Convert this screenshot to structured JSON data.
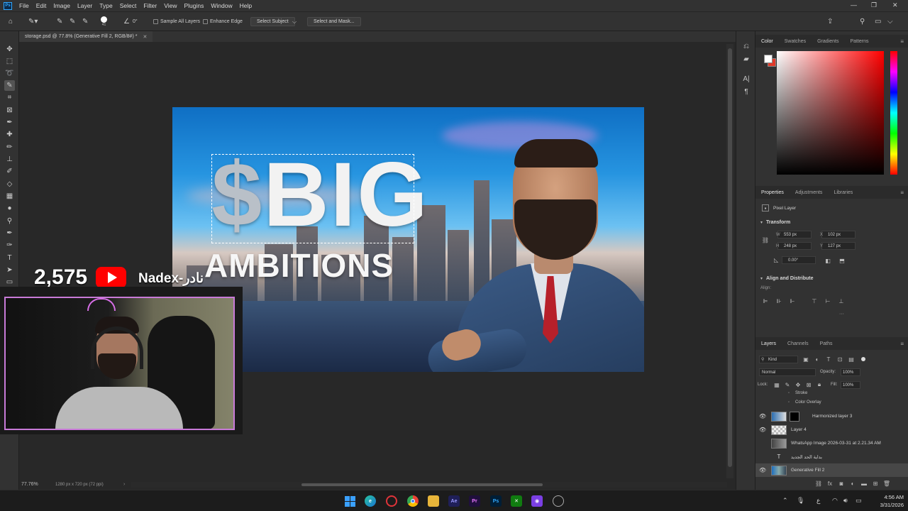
{
  "menubar": {
    "items": [
      "File",
      "Edit",
      "Image",
      "Layer",
      "Type",
      "Select",
      "Filter",
      "View",
      "Plugins",
      "Window",
      "Help"
    ]
  },
  "options": {
    "brush_size": "41",
    "angle": "0°",
    "sample_all_layers": "Sample All Layers",
    "enhance_edge": "Enhance Edge",
    "select_subject": "Select Subject",
    "select_and_mask": "Select and Mask..."
  },
  "document": {
    "tab_title": "storage.psd @ 77.8% (Generative Fill 2, RGB/8#) *",
    "zoom": "77.76%",
    "dimensions": "1280 px x 720 px (72 ppi)"
  },
  "artwork": {
    "headline": "BIG",
    "dollar_glyph": "$",
    "subheadline": "AMBITIONS"
  },
  "color_panel": {
    "tabs": [
      "Color",
      "Swatches",
      "Gradients",
      "Patterns"
    ],
    "active_tab": "Color",
    "foreground": "#ffffff",
    "background": "#e03a2a",
    "hue": "#ff0000"
  },
  "properties": {
    "tabs": [
      "Properties",
      "Adjustments",
      "Libraries"
    ],
    "layer_type": "Pixel Layer",
    "transform_title": "Transform",
    "w_label": "W",
    "h_label": "H",
    "x_label": "X",
    "y_label": "Y",
    "w": "553 px",
    "h": "248 px",
    "x": "102 px",
    "y": "127 px",
    "angle": "0.00°",
    "align_title": "Align and Distribute",
    "align_label": "Align:"
  },
  "layers": {
    "tabs": [
      "Layers",
      "Channels",
      "Paths"
    ],
    "filter": "Kind",
    "blend_mode": "Normal",
    "opacity_label": "Opacity:",
    "opacity": "100%",
    "lock_label": "Lock:",
    "fill_label": "Fill:",
    "fill": "100%",
    "effects": [
      "Stroke",
      "Color Overlay"
    ],
    "rows": [
      {
        "name": "Harmonized layer 3",
        "visible": true
      },
      {
        "name": "Layer 4",
        "visible": true
      },
      {
        "name": "WhatsApp Image 2026-03-31 at 2.21.34 AM",
        "visible": false
      },
      {
        "name": "بداية الحد الجديد",
        "visible": false
      },
      {
        "name": "Generative Fill 2",
        "visible": true,
        "selected": true
      }
    ]
  },
  "overlay": {
    "subscriber_count": "2,575",
    "channel_name": "Nadex-نادر"
  },
  "taskbar": {
    "lang": "ع",
    "time": "4:56 AM",
    "date": "3/31/2026",
    "ae": "Ae",
    "pr": "Pr",
    "ps": "Ps"
  }
}
